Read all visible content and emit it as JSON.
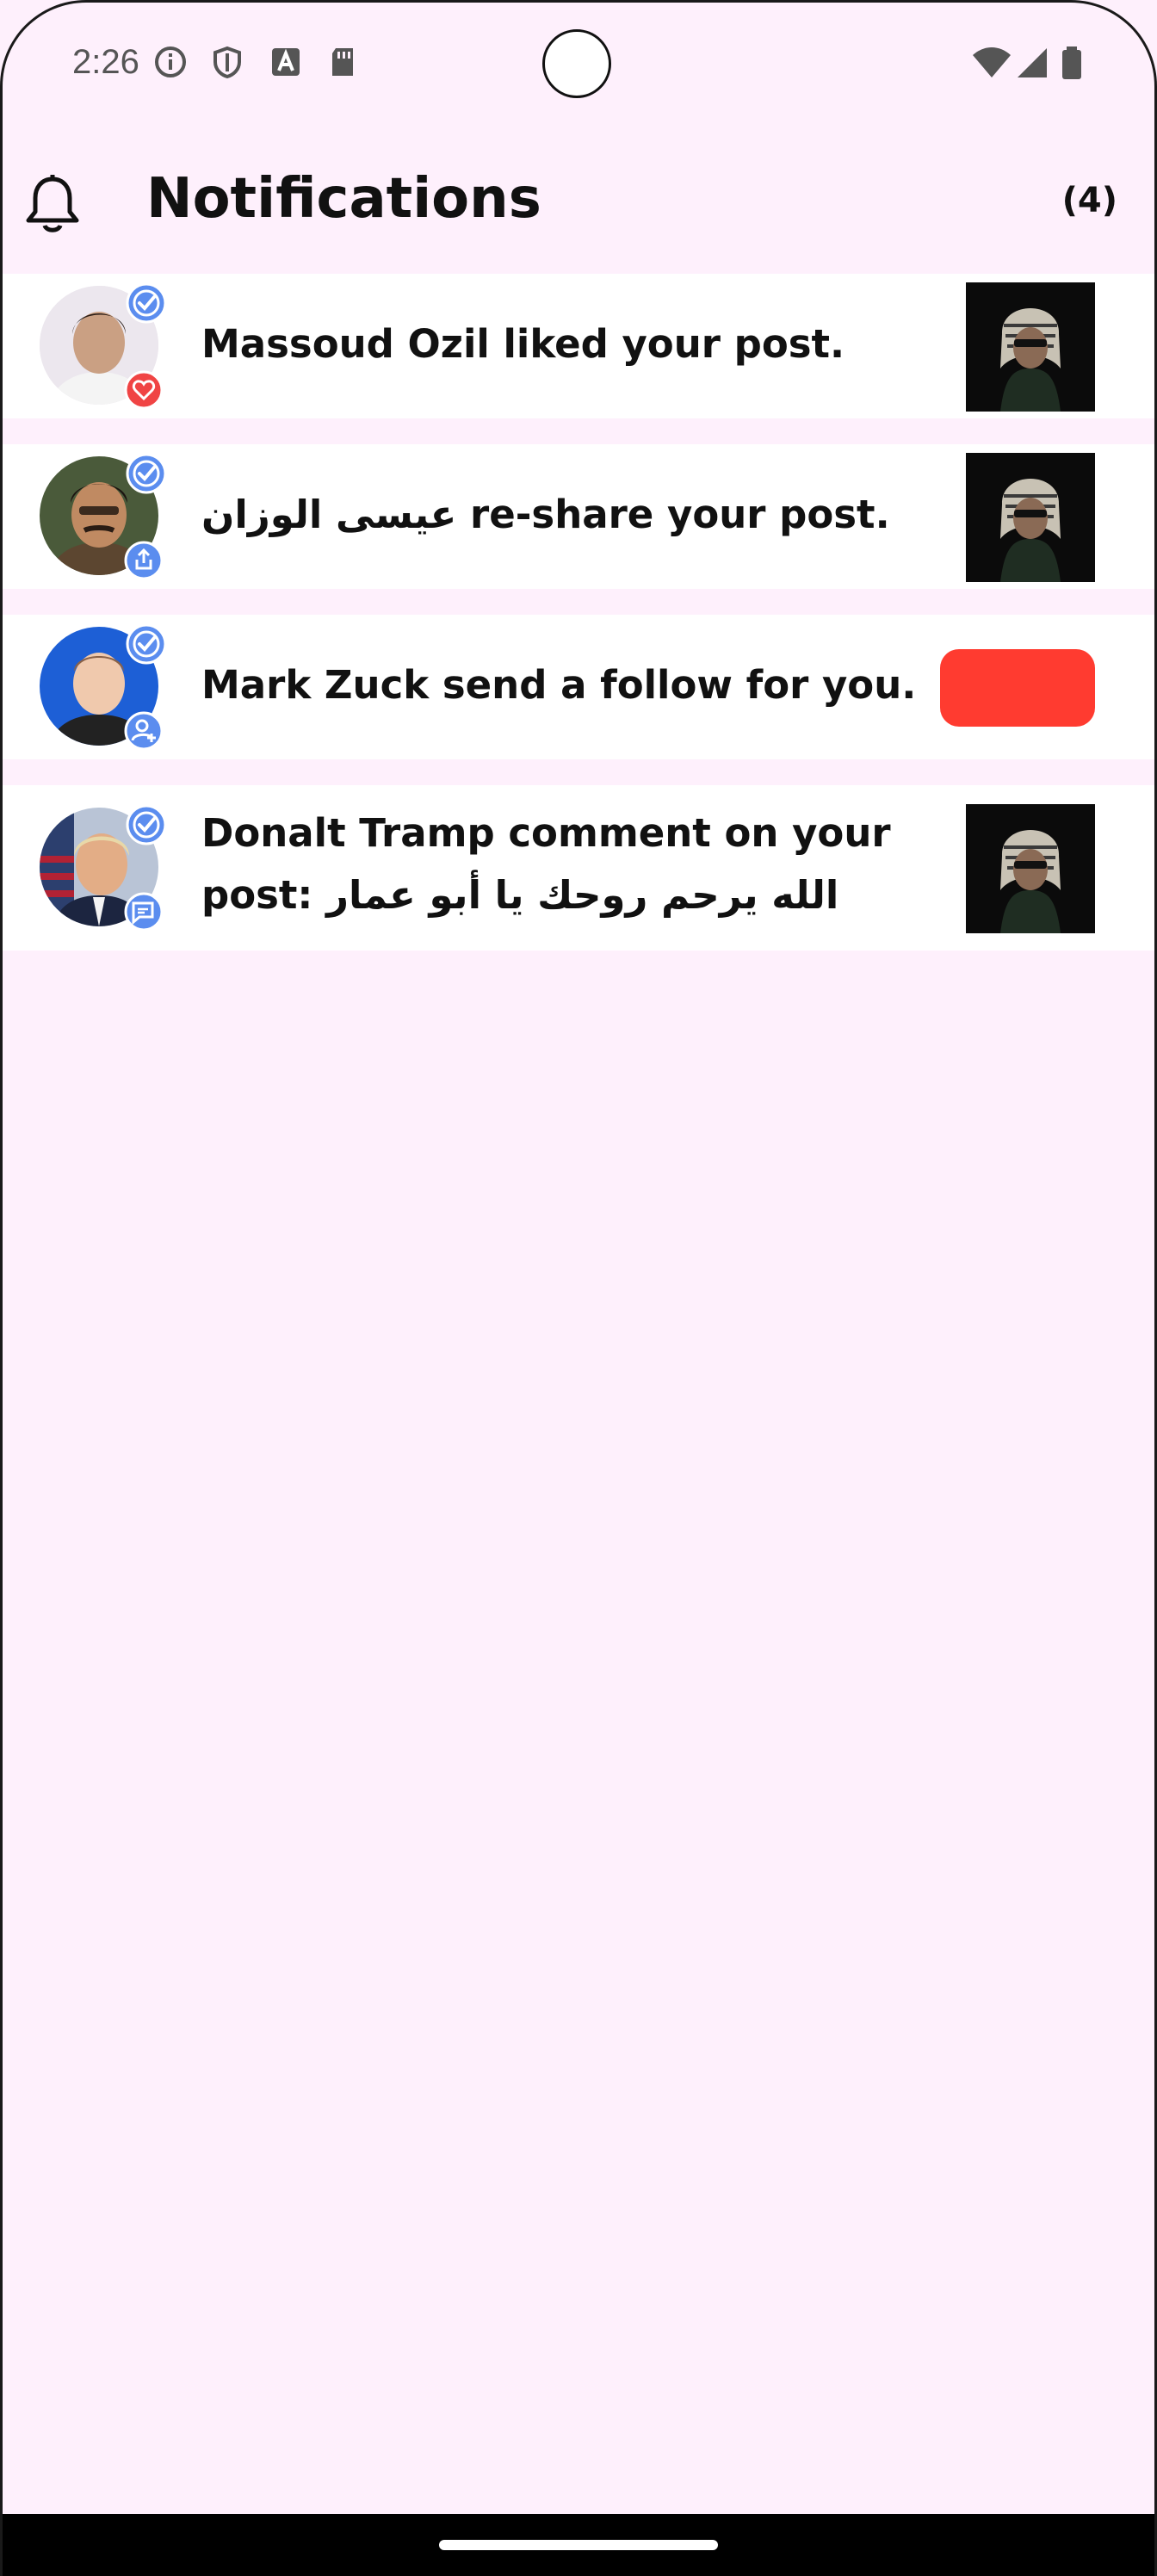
{
  "status_bar": {
    "time": "2:26",
    "icons_left": [
      "info-icon",
      "shield-icon",
      "text-a-icon",
      "sd-card-icon"
    ],
    "icons_right": [
      "wifi-icon",
      "signal-icon",
      "battery-icon"
    ]
  },
  "header": {
    "icon": "bell-icon",
    "title": "Notifications",
    "count": "(4)"
  },
  "colors": {
    "background": "#fef0fc",
    "verified_badge": "#5b8def",
    "like_badge": "#f04444",
    "follow_button": "#ff3b30"
  },
  "notifications": [
    {
      "avatar": "massoud-ozil-avatar",
      "action_icon": "heart-icon",
      "text": "Massoud Ozil liked your post.",
      "trailing": "post-thumbnail"
    },
    {
      "avatar": "user-avatar",
      "action_icon": "share-icon",
      "text": "عيسى الوزان  re-share your post.",
      "trailing": "post-thumbnail"
    },
    {
      "avatar": "mark-zuck-avatar",
      "action_icon": "add-person-icon",
      "text": "Mark Zuck send a follow for you.",
      "trailing": "follow-button"
    },
    {
      "avatar": "donalt-tramp-avatar",
      "action_icon": "comment-icon",
      "text_line1": "Donalt Tramp comment on your",
      "text_line2": "post: الله يرحم روحك يا أبو عمار",
      "trailing": "post-thumbnail"
    }
  ]
}
